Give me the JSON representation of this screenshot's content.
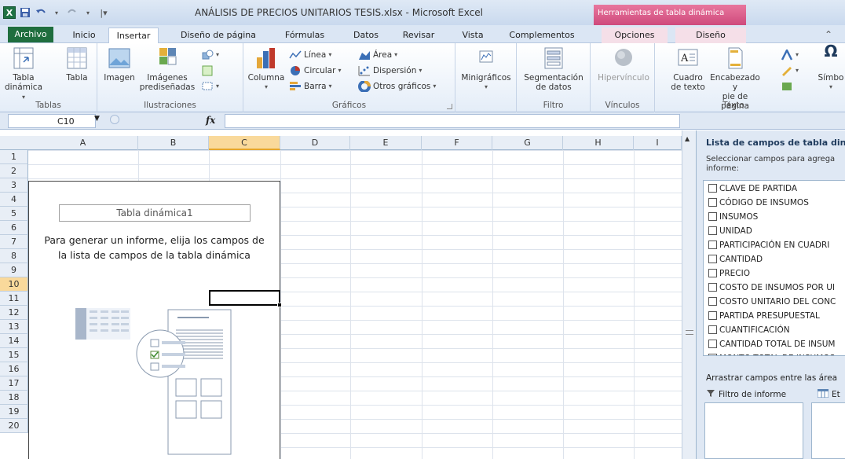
{
  "window": {
    "title": "ANÁLISIS DE PRECIOS UNITARIOS TESIS.xlsx - Microsoft Excel",
    "context_tab_title": "Herramientas de tabla dinámica"
  },
  "tabs": [
    "Archivo",
    "Inicio",
    "Insertar",
    "Diseño de página",
    "Fórmulas",
    "Datos",
    "Revisar",
    "Vista",
    "Complementos",
    "Opciones",
    "Diseño"
  ],
  "active_tab": "Insertar",
  "ribbon": {
    "tablas": {
      "label": "Tablas",
      "tabla_dinamica_1": "Tabla",
      "tabla_dinamica_2": "dinámica",
      "tabla": "Tabla"
    },
    "ilustraciones": {
      "label": "Ilustraciones",
      "imagen": "Imagen",
      "imagenes_1": "Imágenes",
      "imagenes_2": "prediseñadas"
    },
    "graficos": {
      "label": "Gráficos",
      "columna": "Columna",
      "linea": "Línea",
      "circular": "Circular",
      "barra": "Barra",
      "area": "Área",
      "dispersion": "Dispersión",
      "otros": "Otros gráficos"
    },
    "minigraficos": {
      "label": "Minigráficos"
    },
    "filtro": {
      "label": "Filtro",
      "segmentacion_1": "Segmentación",
      "segmentacion_2": "de datos"
    },
    "vinculos": {
      "label": "Vínculos",
      "hipervinculo": "Hipervínculo"
    },
    "texto": {
      "label": "Texto",
      "cuadro_1": "Cuadro",
      "cuadro_2": "de texto",
      "encabezado_1": "Encabezado y",
      "encabezado_2": "pie de página",
      "simbolo": "Símbo"
    }
  },
  "formula_bar": {
    "name_box": "C10",
    "fx": "fx",
    "value": ""
  },
  "columns": [
    "A",
    "B",
    "C",
    "D",
    "E",
    "F",
    "G",
    "H",
    "I"
  ],
  "selected_column": "C",
  "rows": [
    "1",
    "2",
    "3",
    "4",
    "5",
    "6",
    "7",
    "8",
    "9",
    "10",
    "11",
    "12",
    "13",
    "14",
    "15",
    "16",
    "17",
    "18",
    "19",
    "20"
  ],
  "selected_row": "10",
  "pivot": {
    "title": "Tabla dinámica1",
    "message_line1": "Para generar un informe, elija los campos de",
    "message_line2": "la lista de campos de la tabla dinámica"
  },
  "field_list": {
    "title": "Lista de campos de tabla din",
    "hint": "Seleccionar campos para agrega informe:",
    "fields": [
      "CLAVE DE PARTIDA",
      "CÓDIGO DE INSUMOS",
      "INSUMOS",
      "UNIDAD",
      "PARTICIPACIÓN EN CUADRI",
      "CANTIDAD",
      "PRECIO",
      "COSTO DE INSUMOS POR UI",
      "COSTO UNITARIO DEL CONC",
      "PARTIDA PRESUPUESTAL",
      "CUANTIFICACIÓN",
      "CANTIDAD TOTAL DE INSUM",
      "MONTO TOTAL DE INSUMOS"
    ],
    "drag_hint": "Arrastrar campos entre las área",
    "report_filter": "Filtro de informe",
    "column_labels": "Et"
  },
  "colors": {
    "accent": "#1f6e3e",
    "context": "#d94f86",
    "selection": "#f9d99b"
  }
}
